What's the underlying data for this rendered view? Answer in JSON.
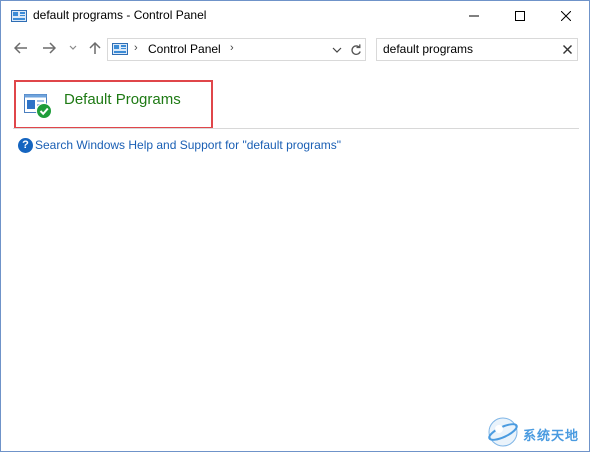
{
  "window": {
    "title": "default programs - Control Panel",
    "controls": {
      "minimize": "minimize",
      "maximize": "maximize",
      "close": "close"
    }
  },
  "nav": {
    "back_icon": "arrow-left-icon",
    "forward_icon": "arrow-right-icon",
    "recent_icon": "chevron-down-icon",
    "up_icon": "arrow-up-icon",
    "breadcrumb": [
      "Control Panel"
    ],
    "refresh_icon": "refresh-icon"
  },
  "search": {
    "value": "default programs",
    "clear_icon": "close-icon"
  },
  "results": [
    {
      "title": "Default Programs",
      "icon": "default-programs-icon"
    }
  ],
  "help": {
    "link_text": "Search Windows Help and Support for \"default programs\""
  },
  "watermark": {
    "text": "系统天地"
  },
  "colors": {
    "result_title": "#1e7a14",
    "highlight_border": "#e0464a",
    "link": "#1a5fb4",
    "window_border": "#6f93c9"
  }
}
